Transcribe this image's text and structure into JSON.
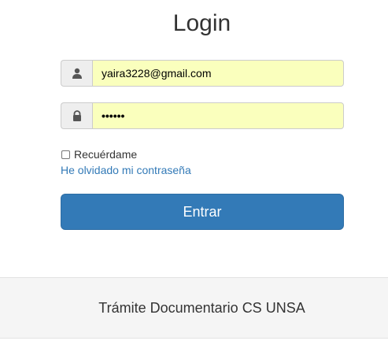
{
  "login": {
    "title": "Login",
    "email": {
      "icon": "user-icon",
      "value": "yaira3228@gmail.com"
    },
    "password": {
      "icon": "lock-icon",
      "value": "••••••"
    },
    "remember_label": "Recuérdame",
    "remember_checked": false,
    "forgot_link": "He olvidado mi contraseña",
    "submit_label": "Entrar"
  },
  "footer": {
    "text": "Trámite Documentario CS UNSA"
  },
  "colors": {
    "primary": "#337ab7",
    "autofill": "#faffbd",
    "addon": "#eeeeee",
    "footer_bg": "#f5f5f5"
  }
}
